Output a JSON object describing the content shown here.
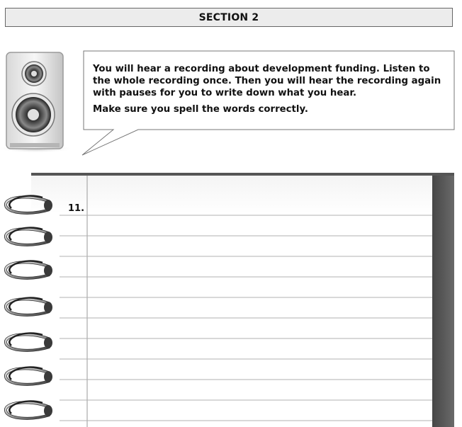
{
  "section": {
    "title": "SECTION 2"
  },
  "instructions": {
    "paragraph1": "You will hear a recording about development funding. Listen to the whole recording once. Then you will hear the recording again with pauses for you to write down what you hear.",
    "paragraph2": "Make sure you spell the words correctly."
  },
  "icons": {
    "speaker": "speaker-icon",
    "rings": "spiral-ring-icon"
  },
  "answer_sheet": {
    "question_number": "11.",
    "line_count": 11
  },
  "colors": {
    "header_bg": "#ececec",
    "border": "#666666",
    "page_shadow": "#555555"
  }
}
